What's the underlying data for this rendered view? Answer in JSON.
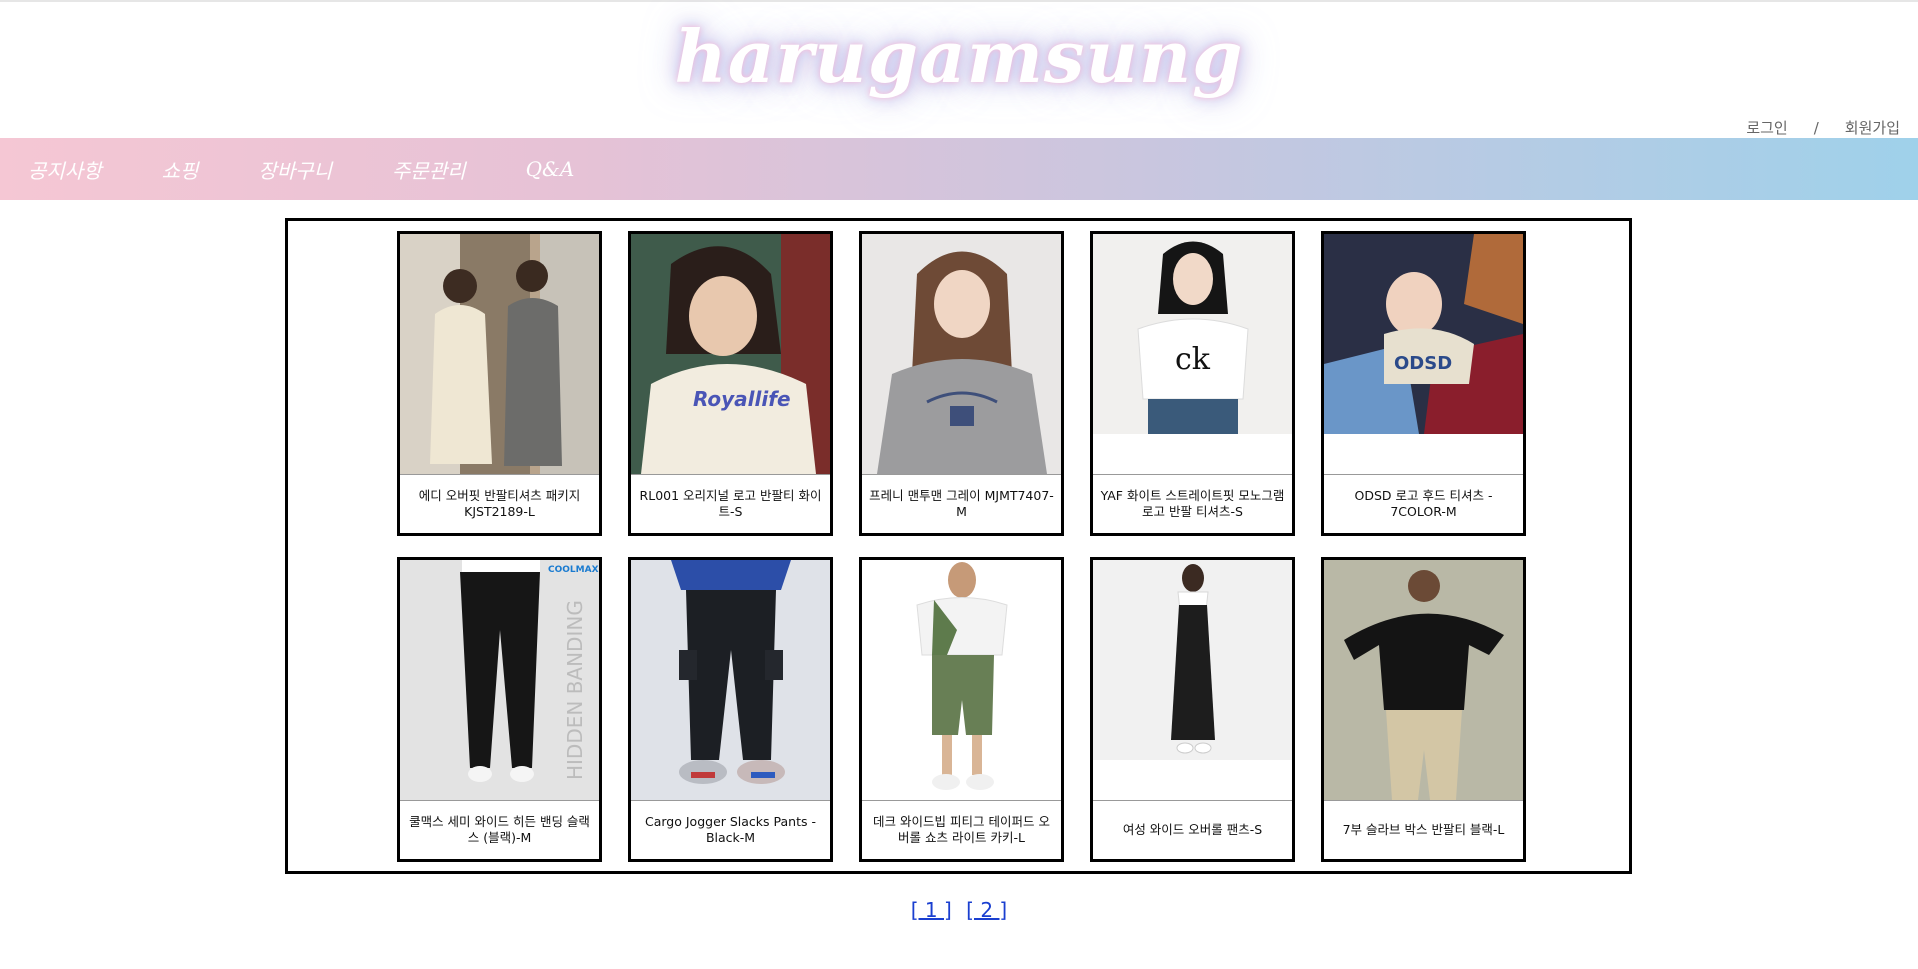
{
  "logo": "harugamsung",
  "auth": {
    "login": "로그인",
    "separator": "/",
    "signup": "회원가입"
  },
  "nav": [
    "공지사항",
    "쇼핑",
    "장바구니",
    "주문관리",
    "Q&A"
  ],
  "products": [
    "에디 오버핏 반팔티셔츠 패키지 KJST2189-L",
    "RL001 오리지널 로고 반팔티 화이트-S",
    "프레니 맨투맨 그레이 MJMT7407-M",
    "YAF 화이트 스트레이트핏 모노그램 로고 반팔 티셔츠-S",
    "ODSD 로고 후드 티셔츠 - 7COLOR-M",
    "쿨맥스 세미 와이드 히든 밴딩 슬랙스 (블랙)-M",
    "Cargo Jogger Slacks Pants - Black-M",
    "데크 와이드빕 피티그 테이퍼드 오버롤 쇼츠 라이트 카키-L",
    "여성 와이드 오버롤 팬츠-S",
    "7부 슬라브 박스 반팔티 블랙-L"
  ],
  "image_text": {
    "royallife": "Royallife",
    "ck": "ck",
    "odsd": "ODSD",
    "coolmax": "COOLMAX",
    "hidden_banding": "HIDDEN BANDING"
  },
  "pagination": [
    "[ 1 ]",
    "[ 2 ]"
  ]
}
